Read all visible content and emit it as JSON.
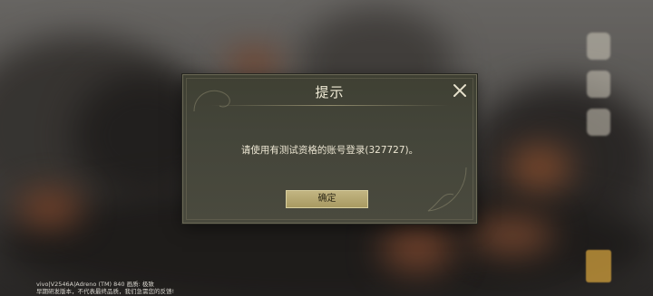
{
  "dialog": {
    "title": "提示",
    "message": "请使用有测试资格的账号登录(327727)。",
    "confirm_label": "确定",
    "close_icon": "close-icon"
  },
  "footer": {
    "device_info": "vivo|V2546A|Adreno (TM) 840    画质: 极致",
    "notice": "早期研发版本，不代表最终品质，我们急需您的反馈!"
  },
  "colors": {
    "dialog_bg": "#44453a",
    "button_bg": "#b5a770",
    "text_light": "#f0ebd6"
  }
}
